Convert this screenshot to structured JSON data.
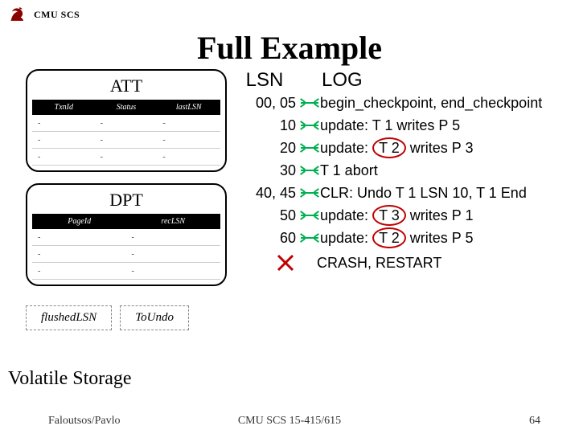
{
  "header": {
    "course_code": "CMU SCS",
    "title": "Full Example"
  },
  "att": {
    "title": "ATT",
    "cols": [
      "TxnId",
      "Status",
      "lastLSN"
    ],
    "rows": [
      [
        "-",
        "-",
        "-"
      ],
      [
        "-",
        "-",
        "-"
      ],
      [
        "-",
        "-",
        "-"
      ]
    ]
  },
  "dpt": {
    "title": "DPT",
    "cols": [
      "PageId",
      "recLSN"
    ],
    "rows": [
      [
        "-",
        "-"
      ],
      [
        "-",
        "-"
      ],
      [
        "-",
        "-"
      ]
    ]
  },
  "boxes": {
    "flushed": "flushedLSN",
    "toundo": "ToUndo"
  },
  "log": {
    "lsn_head": "LSN",
    "log_head": "LOG",
    "entries": [
      {
        "lsn": "00, 05",
        "parts": [
          "begin_checkpoint, end_checkpoint"
        ]
      },
      {
        "lsn": "10",
        "parts": [
          "update: T 1 writes P 5"
        ]
      },
      {
        "lsn": "20",
        "parts": [
          "update: ",
          {
            "circle": "T 2"
          },
          " writes P 3"
        ]
      },
      {
        "lsn": "30",
        "parts": [
          "T 1 abort"
        ]
      },
      {
        "lsn": "40, 45",
        "parts": [
          "CLR: Undo T 1 LSN 10, T 1 End"
        ]
      },
      {
        "lsn": "50",
        "parts": [
          "update: ",
          {
            "circle": "T 3"
          },
          " writes P 1"
        ]
      },
      {
        "lsn": "60",
        "parts": [
          "update: ",
          {
            "circle": "T 2"
          },
          " writes P 5"
        ]
      }
    ],
    "crash": "CRASH, RESTART"
  },
  "labels": {
    "volatile_storage": "Volatile Storage"
  },
  "footer": {
    "left": "Faloutsos/Pavlo",
    "center": "CMU SCS 15-415/615",
    "right": "64"
  }
}
